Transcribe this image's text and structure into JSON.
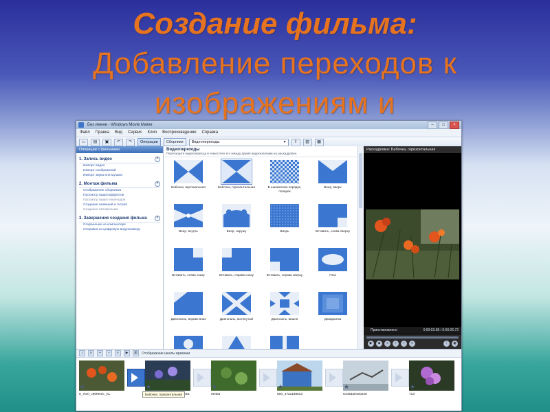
{
  "slide": {
    "title_line1": "Создание фильма:",
    "title_line2": "Добавление переходов к",
    "title_line3": "изображениям и"
  },
  "window": {
    "title": "Без имени - Windows Movie Maker",
    "menu": [
      "Файл",
      "Правка",
      "Вид",
      "Сервис",
      "Клип",
      "Воспроизведение",
      "Справка"
    ],
    "toolbar": {
      "operations_label": "Операции",
      "collections_label": "Сборники",
      "collection_select": "Видеопереходы"
    }
  },
  "tasks": {
    "header": "Операции с фильмами",
    "sections": [
      {
        "title": "1. Запись видео",
        "links": [
          "Импорт видео",
          "Импорт изображений",
          "Импорт звука или музыки"
        ]
      },
      {
        "title": "2. Монтаж фильма",
        "links": [
          "Отображение сборников",
          "Просмотр видеоэффектов",
          "Просмотр видео переходов",
          "Создание названий и титров",
          "Создание автофильма"
        ]
      },
      {
        "title": "3. Завершение создания фильма",
        "links": [
          "Сохранение на компьютере",
          "Отправка на цифровую видеокамеру"
        ]
      }
    ]
  },
  "content": {
    "title": "Видеопереходы",
    "subtitle": "Перетащите видеопереход и поместите его между двумя видеоклипами на раскадровке.",
    "items": [
      {
        "label": "Бабочка, вертикальная"
      },
      {
        "label": "Бабочка, горизонтальная"
      },
      {
        "label": "В шахматном порядке, поперек"
      },
      {
        "label": "Веер, вверх"
      },
      {
        "label": "Веер, внутрь"
      },
      {
        "label": "Веер, наружу"
      },
      {
        "label": "Вихрь"
      },
      {
        "label": "Вставить, слева сверху"
      },
      {
        "label": "Вставить, слева снизу"
      },
      {
        "label": "Вставить, справа снизу"
      },
      {
        "label": "Вставить, справа сверху"
      },
      {
        "label": "Глаз"
      },
      {
        "label": "Диагональ, вправо вниз"
      },
      {
        "label": "Диагональ, вытянутый"
      },
      {
        "label": "Диагональ, вишня"
      },
      {
        "label": "Диафрагма"
      }
    ]
  },
  "preview": {
    "title": "Раскадровка: Бабочка, горизонтальная",
    "status": "Приостановлено",
    "time": "0:00:03.68 / 0:00:26.72"
  },
  "storyboard": {
    "mode_label": "Отображение шкалы времени",
    "tooltip": "Бабочка, горизонтальная",
    "clips": [
      {
        "name": "0_7bef_c90f9eec_XL"
      },
      {
        "name": "0a0ba01a6b741564ed9b532d..."
      },
      {
        "name": "00453"
      },
      {
        "name": "600_47a1198813"
      },
      {
        "name": "6446da04ebb25"
      },
      {
        "name": "713"
      }
    ]
  }
}
